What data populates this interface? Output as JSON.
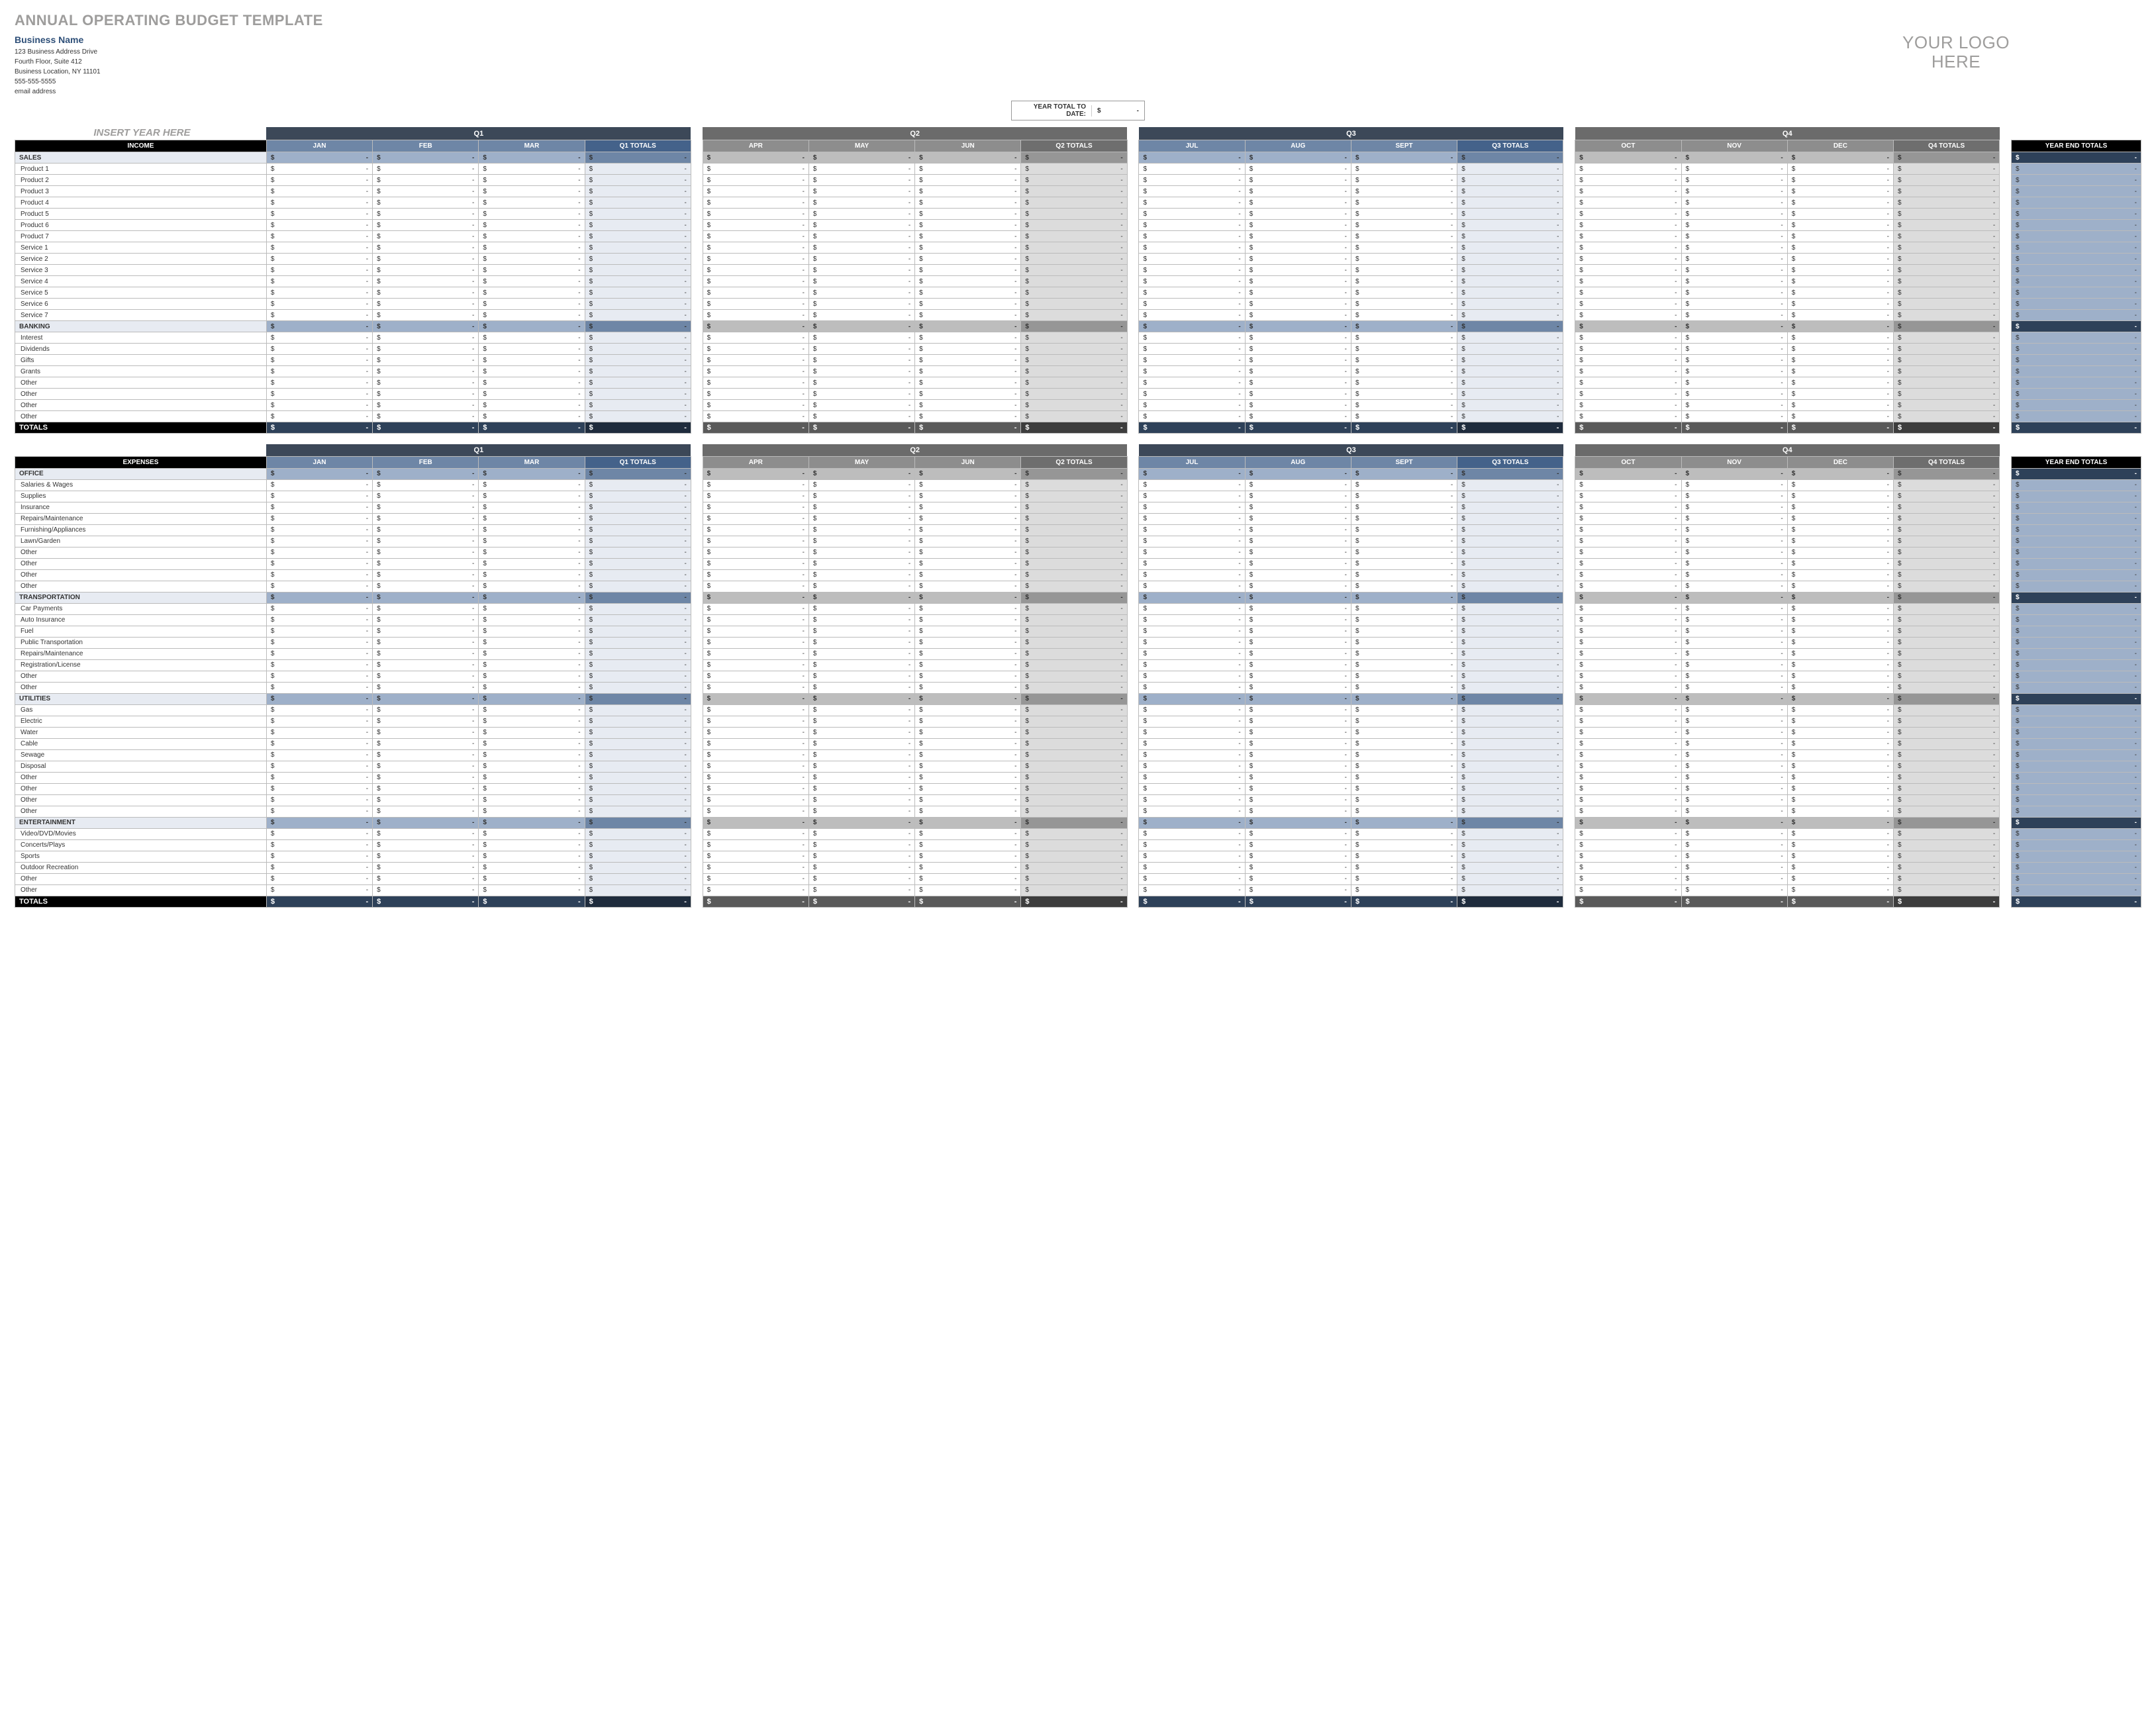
{
  "doc": {
    "title": "ANNUAL OPERATING BUDGET TEMPLATE",
    "business_name": "Business Name",
    "address1": "123 Business Address Drive",
    "address2": "Fourth Floor, Suite 412",
    "address3": "Business Location, NY  11101",
    "phone": "555-555-5555",
    "email": "email address",
    "logo_line1": "YOUR LOGO",
    "logo_line2": "HERE",
    "ytd_label": "YEAR TOTAL TO DATE:",
    "ytd_value": "-",
    "insert_year": "INSERT YEAR HERE"
  },
  "cols": {
    "quarters": [
      "Q1",
      "Q2",
      "Q3",
      "Q4"
    ],
    "months_q1": [
      "JAN",
      "FEB",
      "MAR"
    ],
    "qt1": "Q1 TOTALS",
    "months_q2": [
      "APR",
      "MAY",
      "JUN"
    ],
    "qt2": "Q2 TOTALS",
    "months_q3": [
      "JUL",
      "AUG",
      "SEPT"
    ],
    "qt3": "Q3 TOTALS",
    "months_q4": [
      "OCT",
      "NOV",
      "DEC"
    ],
    "qt4": "Q4 TOTALS",
    "year_end": "YEAR END TOTALS",
    "income_label": "INCOME",
    "expenses_label": "EXPENSES",
    "totals_label": "TOTALS"
  },
  "income": {
    "sections": [
      {
        "name": "SALES",
        "rows": [
          "Product 1",
          "Product 2",
          "Product 3",
          "Product 4",
          "Product 5",
          "Product 6",
          "Product 7",
          "Service 1",
          "Service 2",
          "Service 3",
          "Service 4",
          "Service 5",
          "Service 6",
          "Service 7"
        ]
      },
      {
        "name": "BANKING",
        "rows": [
          "Interest",
          "Dividends",
          "Gifts",
          "Grants",
          "Other",
          "Other",
          "Other",
          "Other"
        ]
      }
    ]
  },
  "expenses": {
    "sections": [
      {
        "name": "OFFICE",
        "rows": [
          "Salaries & Wages",
          "Supplies",
          "Insurance",
          "Repairs/Maintenance",
          "Furnishing/Appliances",
          "Lawn/Garden",
          "Other",
          "Other",
          "Other",
          "Other"
        ]
      },
      {
        "name": "TRANSPORTATION",
        "rows": [
          "Car Payments",
          "Auto Insurance",
          "Fuel",
          "Public Transportation",
          "Repairs/Maintenance",
          "Registration/License",
          "Other",
          "Other"
        ]
      },
      {
        "name": "UTILITIES",
        "rows": [
          "Gas",
          "Electric",
          "Water",
          "Cable",
          "Sewage",
          "Disposal",
          "Other",
          "Other",
          "Other",
          "Other"
        ]
      },
      {
        "name": "ENTERTAINMENT",
        "rows": [
          "Video/DVD/Movies",
          "Concerts/Plays",
          "Sports",
          "Outdoor Recreation",
          "Other",
          "Other"
        ]
      }
    ]
  },
  "cell_currency": "$",
  "cell_empty": "-"
}
